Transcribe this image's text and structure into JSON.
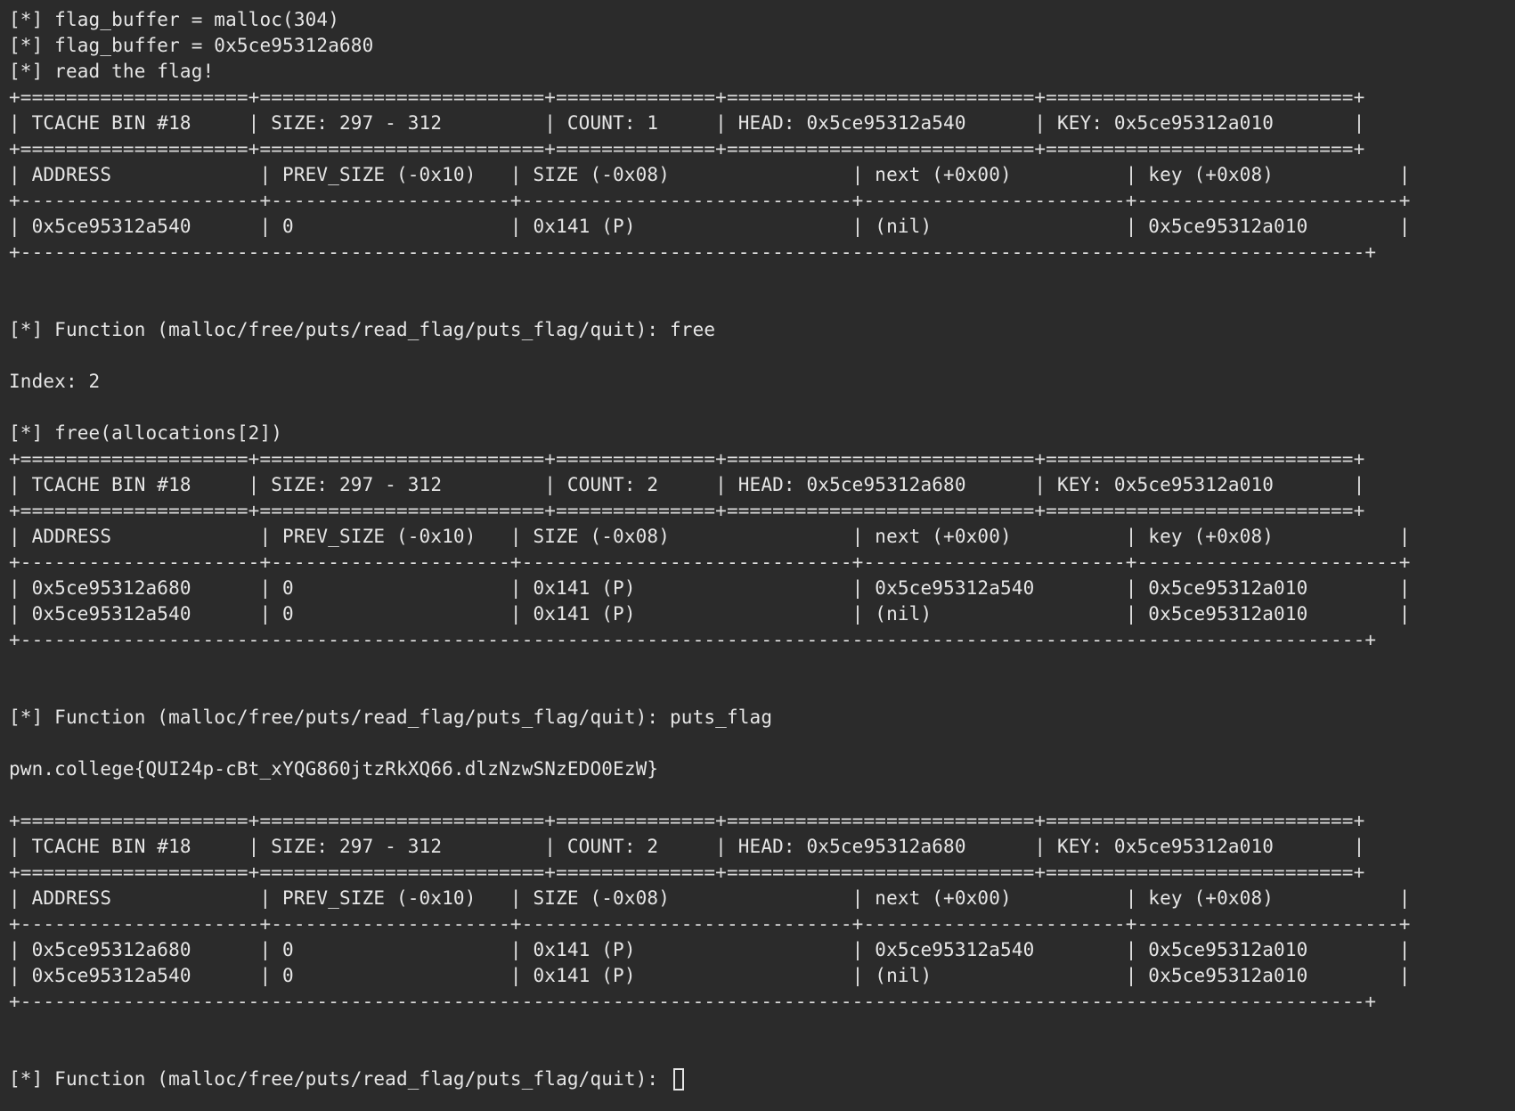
{
  "terminal": {
    "lines": [
      "[*] flag_buffer = malloc(304)",
      "[*] flag_buffer = 0x5ce95312a680",
      "[*] read the flag!",
      "+====================+=========================+==============+===========================+===========================+",
      "| TCACHE BIN #18     | SIZE: 297 - 312         | COUNT: 1     | HEAD: 0x5ce95312a540      | KEY: 0x5ce95312a010       |",
      "+====================+=========================+==============+===========================+===========================+",
      "| ADDRESS             | PREV_SIZE (-0x10)   | SIZE (-0x08)                | next (+0x00)          | key (+0x08)           |",
      "+---------------------+---------------------+-----------------------------+-----------------------+-----------------------+",
      "| 0x5ce95312a540      | 0                   | 0x141 (P)                   | (nil)                 | 0x5ce95312a010        |",
      "+----------------------------------------------------------------------------------------------------------------------+",
      "",
      "",
      "[*] Function (malloc/free/puts/read_flag/puts_flag/quit): free",
      "",
      "Index: 2",
      "",
      "[*] free(allocations[2])",
      "+====================+=========================+==============+===========================+===========================+",
      "| TCACHE BIN #18     | SIZE: 297 - 312         | COUNT: 2     | HEAD: 0x5ce95312a680      | KEY: 0x5ce95312a010       |",
      "+====================+=========================+==============+===========================+===========================+",
      "| ADDRESS             | PREV_SIZE (-0x10)   | SIZE (-0x08)                | next (+0x00)          | key (+0x08)           |",
      "+---------------------+---------------------+-----------------------------+-----------------------+-----------------------+",
      "| 0x5ce95312a680      | 0                   | 0x141 (P)                   | 0x5ce95312a540        | 0x5ce95312a010        |",
      "| 0x5ce95312a540      | 0                   | 0x141 (P)                   | (nil)                 | 0x5ce95312a010        |",
      "+----------------------------------------------------------------------------------------------------------------------+",
      "",
      "",
      "[*] Function (malloc/free/puts/read_flag/puts_flag/quit): puts_flag",
      "",
      "pwn.college{QUI24p-cBt_xYQG860jtzRkXQ66.dlzNzwSNzEDO0EzW}",
      "",
      "+====================+=========================+==============+===========================+===========================+",
      "| TCACHE BIN #18     | SIZE: 297 - 312         | COUNT: 2     | HEAD: 0x5ce95312a680      | KEY: 0x5ce95312a010       |",
      "+====================+=========================+==============+===========================+===========================+",
      "| ADDRESS             | PREV_SIZE (-0x10)   | SIZE (-0x08)                | next (+0x00)          | key (+0x08)           |",
      "+---------------------+---------------------+-----------------------------+-----------------------+-----------------------+",
      "| 0x5ce95312a680      | 0                   | 0x141 (P)                   | 0x5ce95312a540        | 0x5ce95312a010        |",
      "| 0x5ce95312a540      | 0                   | 0x141 (P)                   | (nil)                 | 0x5ce95312a010        |",
      "+----------------------------------------------------------------------------------------------------------------------+",
      "",
      ""
    ],
    "prompt": "[*] Function (malloc/free/puts/read_flag/puts_flag/quit): "
  }
}
